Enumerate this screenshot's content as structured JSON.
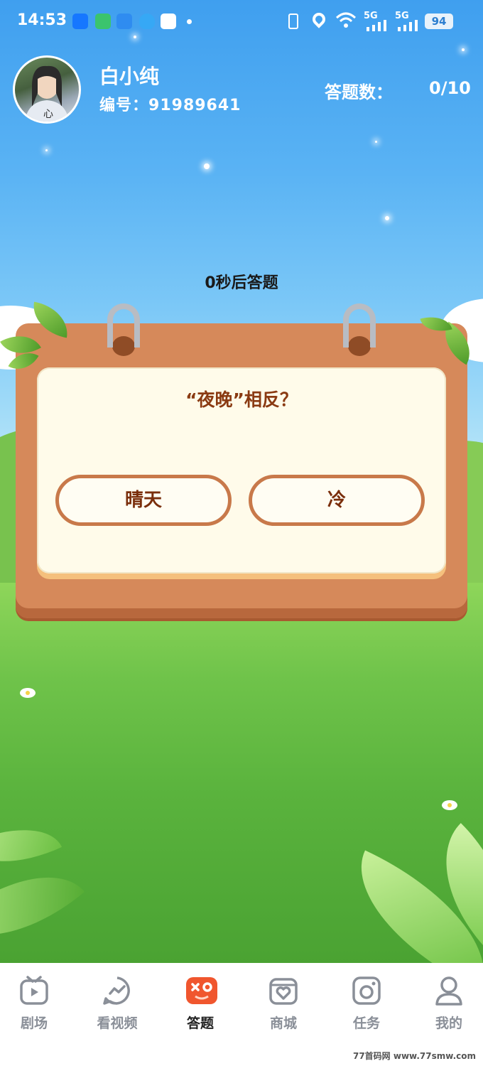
{
  "status_bar": {
    "time": "14:53",
    "signal_1": "5G",
    "signal_2": "5G",
    "battery": "94"
  },
  "user": {
    "name": "白小纯",
    "id_label": "编号：",
    "id_value": "91989641"
  },
  "quiz": {
    "count_label": "答题数：",
    "count_value": "0/10",
    "countdown": "0秒后答题",
    "question": "“夜晚”相反？",
    "options": [
      "晴天",
      "冷"
    ]
  },
  "nav": {
    "items": [
      {
        "label": "剧场",
        "icon": "theater-play-icon"
      },
      {
        "label": "看视频",
        "icon": "video-trend-icon"
      },
      {
        "label": "答题",
        "icon": "quiz-gamepad-icon"
      },
      {
        "label": "商城",
        "icon": "mall-heart-icon"
      },
      {
        "label": "任务",
        "icon": "task-icon"
      },
      {
        "label": "我的",
        "icon": "profile-icon"
      }
    ],
    "active_index": 2
  },
  "colors": {
    "accent": "#f0562e",
    "board": "#d6895a",
    "question_text": "#8a3a12"
  },
  "watermark": "77首码网 www.77smw.com"
}
